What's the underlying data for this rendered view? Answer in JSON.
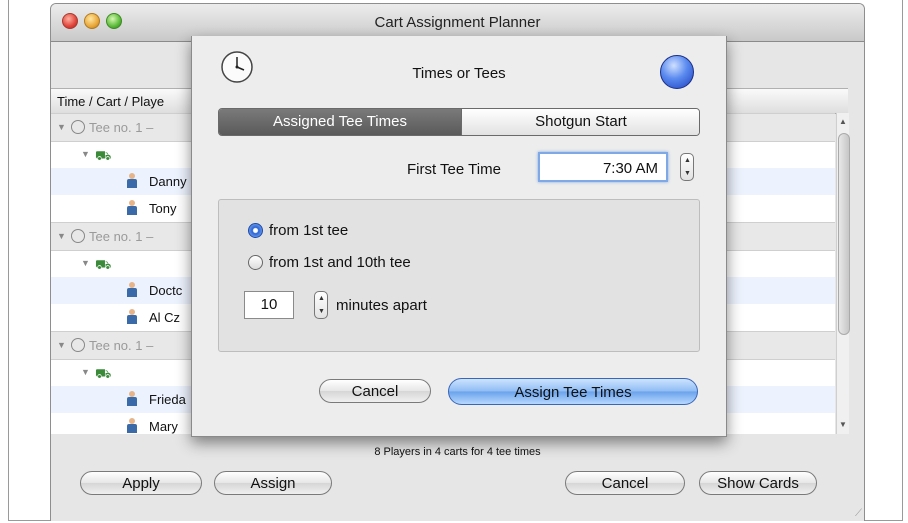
{
  "window": {
    "title": "Cart Assignment Planner"
  },
  "list": {
    "column_header": "Time / Cart / Playe",
    "rows": [
      {
        "kind": "group",
        "label": "Tee no. 1 –"
      },
      {
        "kind": "cart"
      },
      {
        "kind": "player",
        "name": "Danny"
      },
      {
        "kind": "player",
        "name": "Tony"
      },
      {
        "kind": "group",
        "label": "Tee no. 1 –"
      },
      {
        "kind": "cart"
      },
      {
        "kind": "player",
        "name": "Doctc"
      },
      {
        "kind": "player",
        "name": "Al Cz"
      },
      {
        "kind": "group",
        "label": "Tee no. 1 –"
      },
      {
        "kind": "cart"
      },
      {
        "kind": "player",
        "name": "Frieda"
      },
      {
        "kind": "player",
        "name": "Mary"
      }
    ]
  },
  "footer": {
    "status": "8 Players in 4 carts for 4 tee times"
  },
  "buttons": {
    "apply": "Apply",
    "assign": "Assign",
    "cancel": "Cancel",
    "show_cards": "Show Cards"
  },
  "sheet": {
    "title": "Times or Tees",
    "segments": {
      "assigned": "Assigned Tee Times",
      "shotgun": "Shotgun Start"
    },
    "first_tee_time_label": "First Tee Time",
    "first_tee_time_value": "7:30 AM",
    "radio_1st_tee": "from 1st tee",
    "radio_1st_10th": "from 1st and 10th tee",
    "minutes_value": "10",
    "minutes_label": "minutes apart",
    "cancel": "Cancel",
    "assign_tee_times": "Assign Tee Times"
  }
}
